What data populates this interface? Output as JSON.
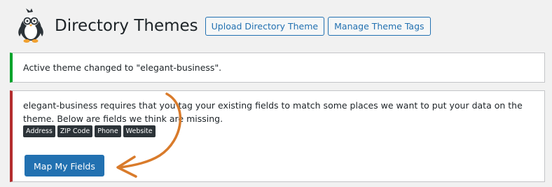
{
  "header": {
    "title": "Directory Themes",
    "buttons": [
      "Upload Directory Theme",
      "Manage Theme Tags"
    ]
  },
  "success_notice": {
    "text": "Active theme changed to \"elegant-business\"."
  },
  "warning_notice": {
    "text": "elegant-business requires that you tag your existing fields to match some places we want to put your data on the theme. Below are fields we think are missing.",
    "tags": [
      "Address",
      "ZIP Code",
      "Phone",
      "Website"
    ],
    "button_label": "Map My Fields"
  },
  "colors": {
    "primary": "#2271b1",
    "success_border": "#00a32a",
    "warning_border": "#b32d2e",
    "arrow": "#d97b2b"
  },
  "icons": {
    "logo": "penguin-logo-icon",
    "annotation": "curved-arrow-icon"
  }
}
